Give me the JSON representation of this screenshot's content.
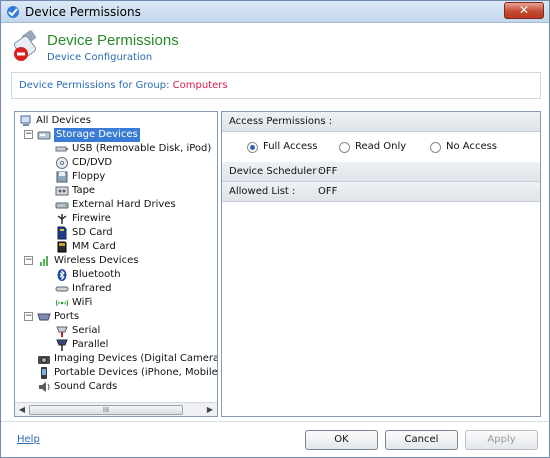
{
  "window": {
    "title": "Device Permissions",
    "close_glyph": "✕"
  },
  "header": {
    "title": "Device Permissions",
    "subtitle": "Device Configuration"
  },
  "group": {
    "label": "Device Permissions for Group:",
    "value": "Computers"
  },
  "tree": {
    "root": "All Devices",
    "storage": {
      "label": "Storage Devices",
      "expander": "−",
      "items": [
        "USB (Removable Disk, iPod)",
        "CD/DVD",
        "Floppy",
        "Tape",
        "External Hard Drives",
        "Firewire",
        "SD Card",
        "MM Card"
      ]
    },
    "wireless": {
      "label": "Wireless Devices",
      "expander": "−",
      "items": [
        "Bluetooth",
        "Infrared",
        "WiFi"
      ]
    },
    "ports": {
      "label": "Ports",
      "expander": "−",
      "items": [
        "Serial",
        "Parallel"
      ]
    },
    "others": [
      "Imaging Devices (Digital Camera, Web",
      "Portable Devices (iPhone, Mobiles)",
      "Sound Cards"
    ],
    "scroll": {
      "left": "◀",
      "right": "▶",
      "grip": "III"
    }
  },
  "access": {
    "header": "Access Permissions :",
    "options": [
      "Full Access",
      "Read Only",
      "No Access"
    ],
    "selected": "Full Access"
  },
  "scheduler": {
    "label": "Device Scheduler :",
    "value": "OFF"
  },
  "allowed": {
    "label": "Allowed List :",
    "value": "OFF"
  },
  "footer": {
    "help": "Help",
    "ok": "OK",
    "cancel": "Cancel",
    "apply": "Apply"
  }
}
